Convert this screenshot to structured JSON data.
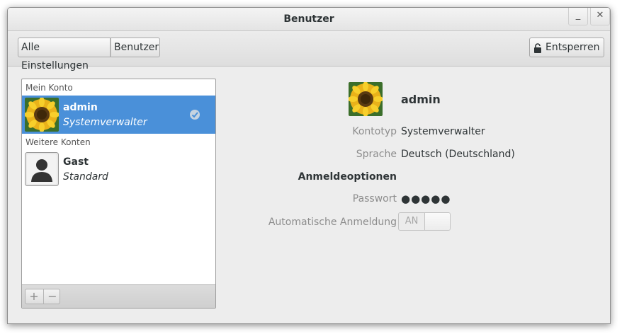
{
  "window": {
    "title": "Benutzer",
    "minimize_symbol": "_",
    "close_symbol": "✕"
  },
  "toolbar": {
    "breadcrumbs": [
      "Alle Einstellungen",
      "Benutzer"
    ],
    "unlock_label": "Entsperren",
    "unlock_icon": "lock-icon"
  },
  "accounts": {
    "my_account_header": "Mein Konto",
    "other_accounts_header": "Weitere Konten",
    "my": {
      "name": "admin",
      "role": "Systemverwalter",
      "avatar": "sunflower-avatar",
      "selected": true
    },
    "others": [
      {
        "name": "Gast",
        "role": "Standard",
        "avatar": "generic-person-avatar"
      }
    ],
    "add_symbol": "+",
    "remove_symbol": "−"
  },
  "details": {
    "name": "admin",
    "account_type_label": "Kontotyp",
    "account_type_value": "Systemverwalter",
    "language_label": "Sprache",
    "language_value": "Deutsch (Deutschland)",
    "login_options_header": "Anmeldeoptionen",
    "password_label": "Passwort",
    "password_value": "●●●●●",
    "autologin_label": "Automatische Anmeldung",
    "autologin_state": "AN"
  },
  "colors": {
    "selection": "#4a90d9",
    "window_bg": "#ededed"
  }
}
